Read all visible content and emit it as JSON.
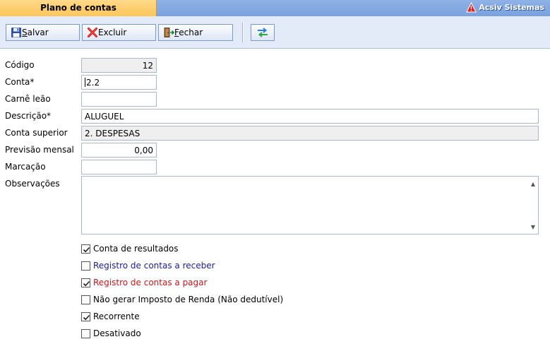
{
  "window": {
    "title": "Plano de contas",
    "brand": "Acsiv Sistemas"
  },
  "toolbar": {
    "save_label": "Salvar",
    "save_mnemonic": "S",
    "delete_label": "Excluir",
    "close_label": "Fechar",
    "close_mnemonic": "F"
  },
  "form": {
    "codigo": {
      "label": "Código",
      "value": "12"
    },
    "conta": {
      "label": "Conta*",
      "value": "2.2"
    },
    "carne_leao": {
      "label": "Carnê leão",
      "value": ""
    },
    "descricao": {
      "label": "Descrição*",
      "value": "ALUGUEL"
    },
    "conta_superior": {
      "label": "Conta superior",
      "value": "2. DESPESAS"
    },
    "previsao_mensal": {
      "label": "Previsão mensal",
      "value": "0,00"
    },
    "marcacao": {
      "label": "Marcação",
      "value": ""
    },
    "observacoes": {
      "label": "Observações",
      "value": ""
    }
  },
  "checkboxes": [
    {
      "label": "Conta de resultados",
      "checked": true,
      "color": "#000000"
    },
    {
      "label": "Registro de contas a receber",
      "checked": false,
      "color": "#1a1aa6"
    },
    {
      "label": "Registro de contas a pagar",
      "checked": true,
      "color": "#d4141a"
    },
    {
      "label": "Não gerar Imposto de Renda (Não dedutível)",
      "checked": false,
      "color": "#000000"
    },
    {
      "label": "Recorrente",
      "checked": true,
      "color": "#000000"
    },
    {
      "label": "Desativado",
      "checked": false,
      "color": "#000000"
    }
  ],
  "icons": {
    "save": "floppy-disk-icon",
    "delete": "red-x-icon",
    "close": "door-exit-icon",
    "swap": "swap-arrows-icon",
    "brand": "warning-triangle-icon"
  }
}
